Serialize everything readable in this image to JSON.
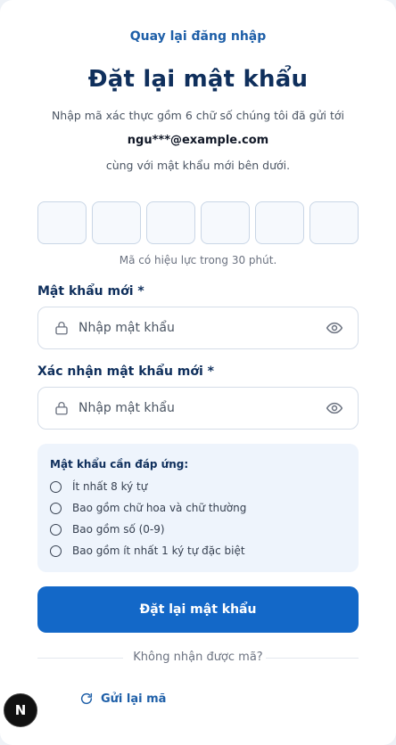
{
  "back_link": "Quay lại đăng nhập",
  "title": "Đặt lại mật khẩu",
  "description_line1": "Nhập mã xác thực gồm 6 chữ số chúng tôi đã gửi tới",
  "email": "ngu***@example.com",
  "description_line2": "cùng với mật khẩu mới bên dưới.",
  "otp": {
    "digits": [
      "",
      "",
      "",
      "",
      "",
      ""
    ],
    "validity_note": "Mã có hiệu lực trong 30 phút."
  },
  "new_password": {
    "label": "Mật khẩu mới *",
    "placeholder": "Nhập mật khẩu",
    "value": ""
  },
  "confirm_password": {
    "label": "Xác nhận mật khẩu mới *",
    "placeholder": "Nhập mật khẩu",
    "value": ""
  },
  "requirements": {
    "title": "Mật khẩu cần đáp ứng:",
    "items": [
      "Ít nhất 8 ký tự",
      "Bao gồm chữ hoa và chữ thường",
      "Bao gồm số (0-9)",
      "Bao gồm ít nhất 1 ký tự đặc biệt"
    ]
  },
  "submit_label": "Đặt lại mật khẩu",
  "no_code_text": "Không nhận được mã?",
  "resend_label": "Gửi lại mã",
  "badge_letter": "N",
  "colors": {
    "primary": "#1368c8",
    "title": "#0f2f5c",
    "link": "#1e5fa8",
    "requirements_bg": "#eef4fc"
  },
  "icons": {
    "field_leading": "lock-icon",
    "field_trailing": "eye-icon",
    "resend": "refresh-icon"
  }
}
